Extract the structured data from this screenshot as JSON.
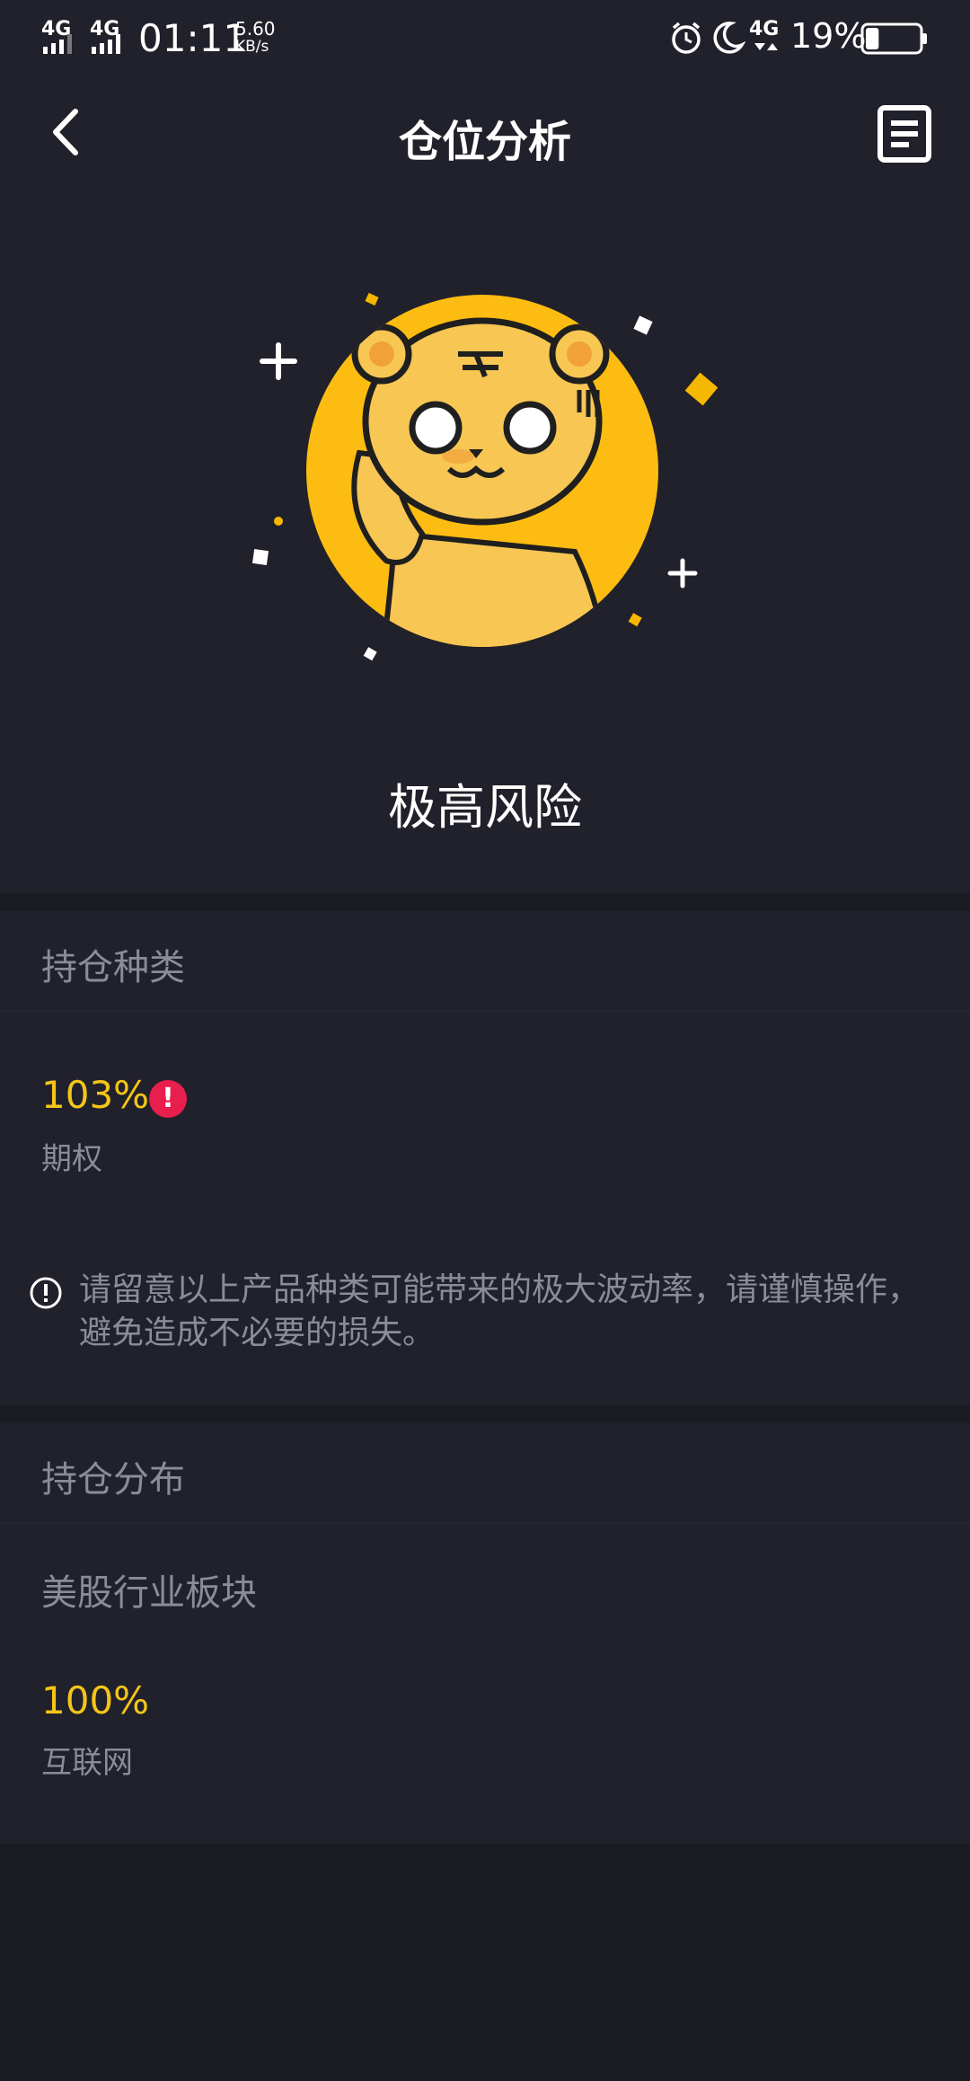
{
  "status_bar": {
    "signal1": "4G",
    "signal2": "4G",
    "time": "01:11",
    "speed_value": "5.60",
    "speed_unit": "KB/s",
    "network": "4G",
    "battery_percent": "19%",
    "battery_level": 0.19,
    "icons": [
      "alarm-icon",
      "moon-icon",
      "network-icon",
      "battery-icon"
    ]
  },
  "header": {
    "title": "仓位分析",
    "back_icon": "chevron-left-icon",
    "report_icon": "document-icon"
  },
  "risk": {
    "label": "极高风险",
    "illustration": "tiger-mascot",
    "accent_color": "#f5b800"
  },
  "holding_types": {
    "title": "持仓种类",
    "items": [
      {
        "percent": "103%",
        "name": "期权",
        "warning": "!"
      }
    ],
    "notice": "请留意以上产品种类可能带来的极大波动率，请谨慎操作，避免造成不必要的损失。"
  },
  "holding_distribution": {
    "title": "持仓分布",
    "subtitle": "美股行业板块",
    "items": [
      {
        "percent": "100%",
        "name": "互联网"
      }
    ]
  },
  "colors": {
    "background": "#1b1b23",
    "card": "#21212b",
    "highlight": "#f5c518",
    "muted_text": "#8b8b9a",
    "warning": "#e81e4d"
  }
}
